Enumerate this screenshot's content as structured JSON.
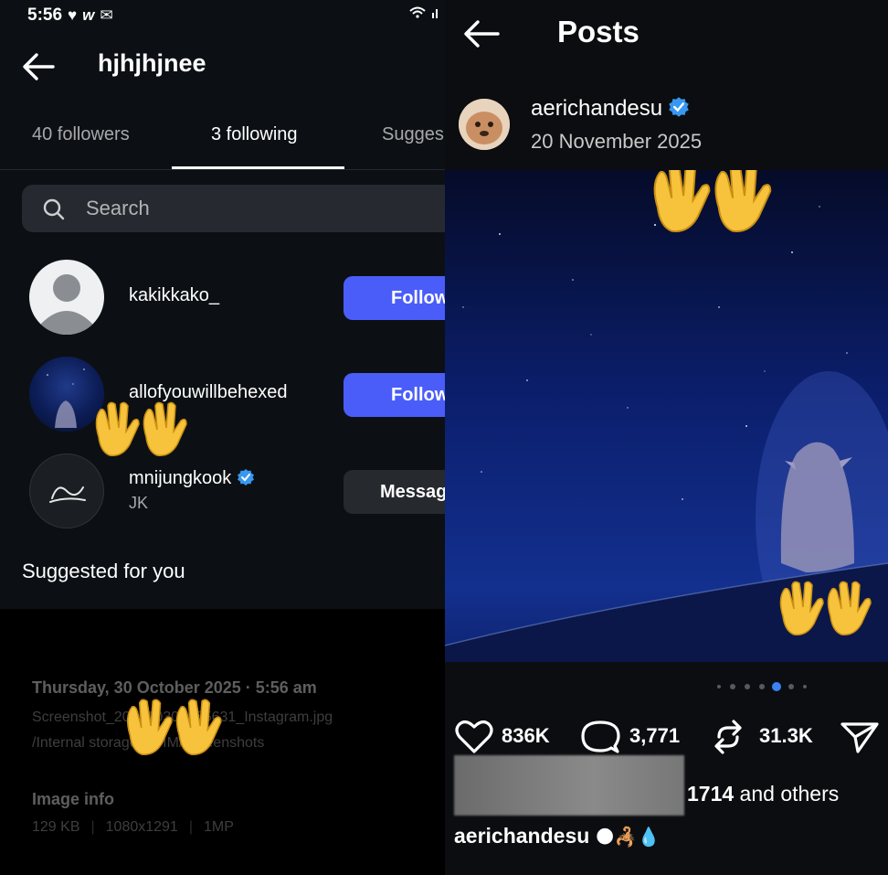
{
  "status_bar": {
    "time": "5:56",
    "icons": [
      "heart-icon",
      "app-w-icon",
      "mail-icon"
    ],
    "right_icons": "wifi-signal-icon"
  },
  "left_panel": {
    "profile_title": "hjhjhjnee",
    "tabs": [
      {
        "label": "40 followers",
        "active": false
      },
      {
        "label": "3 following",
        "active": true
      },
      {
        "label": "Sugges",
        "active": false
      }
    ],
    "search": {
      "placeholder": "Search"
    },
    "following": [
      {
        "username": "kakikkako_",
        "subtitle": "",
        "action": "Follow",
        "verified": false
      },
      {
        "username": "allofyouwillbehexed",
        "subtitle": "",
        "action": "Follow",
        "verified": false
      },
      {
        "username": "mnijungkook",
        "subtitle": "JK",
        "action": "Messag",
        "verified": true
      }
    ],
    "suggested_heading": "Suggested for you",
    "image_details": {
      "date": "Thursday, 30 October 2025 · 5:56 am",
      "filename": "Screenshot_20251030_055631_Instagram.jpg",
      "path": "/Internal storage/DCIM/Screenshots",
      "info_heading": "Image info",
      "size": "129 KB",
      "resolution": "1080x1291",
      "megapixels": "1MP"
    }
  },
  "right_panel": {
    "title": "Posts",
    "post": {
      "username": "aerichandesu",
      "verified": true,
      "date": "20 November 2025",
      "likes": "836K",
      "comments": "3,771",
      "reposts": "31.3K",
      "liked_by_suffix": "1714",
      "liked_by_rest": " and others",
      "caption_user": "aerichandesu",
      "caption_emoji": "🌑🦂💧",
      "carousel_count": 6,
      "carousel_active": 4
    }
  },
  "colors": {
    "follow_button": "#4a5df9",
    "verified": "#3897f0",
    "background": "#0c1014"
  }
}
